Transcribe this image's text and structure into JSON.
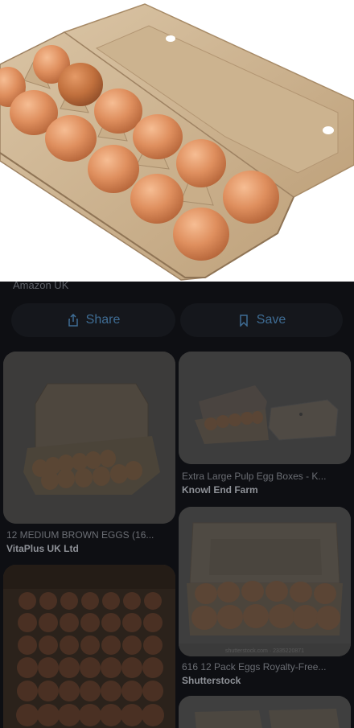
{
  "hero": {
    "source": "Amazon UK"
  },
  "actions": {
    "share_label": "Share",
    "save_label": "Save"
  },
  "results": [
    {
      "title": "12 MEDIUM BROWN EGGS (16...",
      "source": "VitaPlus UK Ltd"
    },
    {
      "title": "Extra Large Pulp Egg Boxes - K...",
      "source": "Knowl End Farm"
    },
    {
      "title": "",
      "source": ""
    },
    {
      "title": "616 12 Pack Eggs Royalty-Free...",
      "source": "Shutterstock",
      "watermark": "shutterstock.com · 2335220871"
    },
    {
      "title": "",
      "source": ""
    }
  ],
  "colors": {
    "accent": "#3f6d95",
    "background": "#0e0f13",
    "card": "#15171c"
  },
  "icons": {
    "share": "share-icon",
    "save": "bookmark-icon"
  }
}
